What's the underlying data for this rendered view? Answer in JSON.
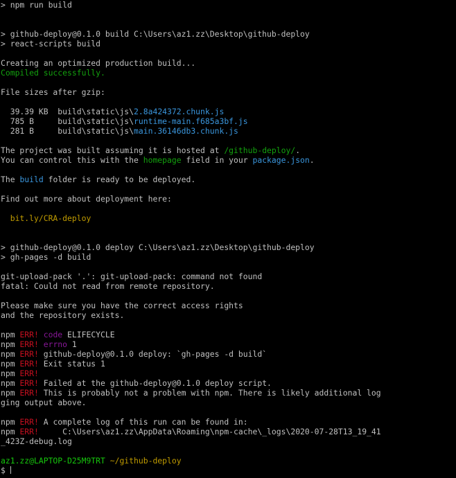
{
  "terminal": {
    "lines": [
      [
        {
          "t": "> npm run build",
          "c": "white"
        }
      ],
      [
        {
          "t": "",
          "c": "white"
        }
      ],
      [
        {
          "t": "",
          "c": "white"
        }
      ],
      [
        {
          "t": "> github-deploy@0.1.0 build C:\\Users\\az1.zz\\Desktop\\github-deploy",
          "c": "white"
        }
      ],
      [
        {
          "t": "> react-scripts build",
          "c": "white"
        }
      ],
      [
        {
          "t": "",
          "c": "white"
        }
      ],
      [
        {
          "t": "Creating an optimized production build...",
          "c": "white"
        }
      ],
      [
        {
          "t": "Compiled successfully.",
          "c": "green"
        }
      ],
      [
        {
          "t": "",
          "c": "white"
        }
      ],
      [
        {
          "t": "File sizes after gzip:",
          "c": "white"
        }
      ],
      [
        {
          "t": "",
          "c": "white"
        }
      ],
      [
        {
          "t": "  39.39 KB  build\\static\\js\\",
          "c": "white"
        },
        {
          "t": "2.8a424372.chunk.js",
          "c": "cyan"
        }
      ],
      [
        {
          "t": "  785 B     build\\static\\js\\",
          "c": "white"
        },
        {
          "t": "runtime-main.f685a3bf.js",
          "c": "cyan"
        }
      ],
      [
        {
          "t": "  281 B     build\\static\\js\\",
          "c": "white"
        },
        {
          "t": "main.36146db3.chunk.js",
          "c": "cyan"
        }
      ],
      [
        {
          "t": "",
          "c": "white"
        }
      ],
      [
        {
          "t": "The project was built assuming it is hosted at ",
          "c": "white"
        },
        {
          "t": "/github-deploy/",
          "c": "green"
        },
        {
          "t": ".",
          "c": "white"
        }
      ],
      [
        {
          "t": "You can control this with the ",
          "c": "white"
        },
        {
          "t": "homepage",
          "c": "green"
        },
        {
          "t": " field in your ",
          "c": "white"
        },
        {
          "t": "package.json",
          "c": "cyan"
        },
        {
          "t": ".",
          "c": "white"
        }
      ],
      [
        {
          "t": "",
          "c": "white"
        }
      ],
      [
        {
          "t": "The ",
          "c": "white"
        },
        {
          "t": "build",
          "c": "cyan"
        },
        {
          "t": " folder is ready to be deployed.",
          "c": "white"
        }
      ],
      [
        {
          "t": "",
          "c": "white"
        }
      ],
      [
        {
          "t": "Find out more about deployment here:",
          "c": "white"
        }
      ],
      [
        {
          "t": "",
          "c": "white"
        }
      ],
      [
        {
          "t": "  bit.ly/CRA-deploy",
          "c": "yellow"
        }
      ],
      [
        {
          "t": "",
          "c": "white"
        }
      ],
      [
        {
          "t": "",
          "c": "white"
        }
      ],
      [
        {
          "t": "> github-deploy@0.1.0 deploy C:\\Users\\az1.zz\\Desktop\\github-deploy",
          "c": "white"
        }
      ],
      [
        {
          "t": "> gh-pages -d build",
          "c": "white"
        }
      ],
      [
        {
          "t": "",
          "c": "white"
        }
      ],
      [
        {
          "t": "git-upload-pack '.': git-upload-pack: command not found",
          "c": "white"
        }
      ],
      [
        {
          "t": "fatal: Could not read from remote repository.",
          "c": "white"
        }
      ],
      [
        {
          "t": "",
          "c": "white"
        }
      ],
      [
        {
          "t": "Please make sure you have the correct access rights",
          "c": "white"
        }
      ],
      [
        {
          "t": "and the repository exists.",
          "c": "white"
        }
      ],
      [
        {
          "t": "",
          "c": "white"
        }
      ],
      [
        {
          "t": "npm ",
          "c": "white"
        },
        {
          "t": "ERR!",
          "c": "red"
        },
        {
          "t": " ",
          "c": "white"
        },
        {
          "t": "code",
          "c": "magenta"
        },
        {
          "t": " ELIFECYCLE",
          "c": "white"
        }
      ],
      [
        {
          "t": "npm ",
          "c": "white"
        },
        {
          "t": "ERR!",
          "c": "red"
        },
        {
          "t": " ",
          "c": "white"
        },
        {
          "t": "errno",
          "c": "magenta"
        },
        {
          "t": " 1",
          "c": "white"
        }
      ],
      [
        {
          "t": "npm ",
          "c": "white"
        },
        {
          "t": "ERR!",
          "c": "red"
        },
        {
          "t": " github-deploy@0.1.0 deploy: `gh-pages -d build`",
          "c": "white"
        }
      ],
      [
        {
          "t": "npm ",
          "c": "white"
        },
        {
          "t": "ERR!",
          "c": "red"
        },
        {
          "t": " Exit status 1",
          "c": "white"
        }
      ],
      [
        {
          "t": "npm ",
          "c": "white"
        },
        {
          "t": "ERR!",
          "c": "red"
        }
      ],
      [
        {
          "t": "npm ",
          "c": "white"
        },
        {
          "t": "ERR!",
          "c": "red"
        },
        {
          "t": " Failed at the github-deploy@0.1.0 deploy script.",
          "c": "white"
        }
      ],
      [
        {
          "t": "npm ",
          "c": "white"
        },
        {
          "t": "ERR!",
          "c": "red"
        },
        {
          "t": " This is probably not a problem with npm. There is likely additional log",
          "c": "white"
        }
      ],
      [
        {
          "t": "ging output above.",
          "c": "white"
        }
      ],
      [
        {
          "t": "",
          "c": "white"
        }
      ],
      [
        {
          "t": "npm ",
          "c": "white"
        },
        {
          "t": "ERR!",
          "c": "red"
        },
        {
          "t": " A complete log of this run can be found in:",
          "c": "white"
        }
      ],
      [
        {
          "t": "npm ",
          "c": "white"
        },
        {
          "t": "ERR!",
          "c": "red"
        },
        {
          "t": "     C:\\Users\\az1.zz\\AppData\\Roaming\\npm-cache\\_logs\\2020-07-28T13_19_41",
          "c": "white"
        }
      ],
      [
        {
          "t": "_423Z-debug.log",
          "c": "white"
        }
      ],
      [
        {
          "t": "",
          "c": "white"
        }
      ],
      [
        {
          "t": "az1.zz@LAPTOP-D25M9TRT",
          "c": "bgreen"
        },
        {
          "t": " ",
          "c": "white"
        },
        {
          "t": "~/github-deploy",
          "c": "yellow"
        }
      ]
    ],
    "prompt_symbol": "$ "
  },
  "colors": {
    "background": "#000000",
    "white": "#c0c0c0",
    "green": "#13a10e",
    "cyan": "#3a96dd",
    "yellow": "#c19c00",
    "red": "#c50f1f",
    "magenta": "#881798",
    "bgreen": "#16c60c"
  }
}
